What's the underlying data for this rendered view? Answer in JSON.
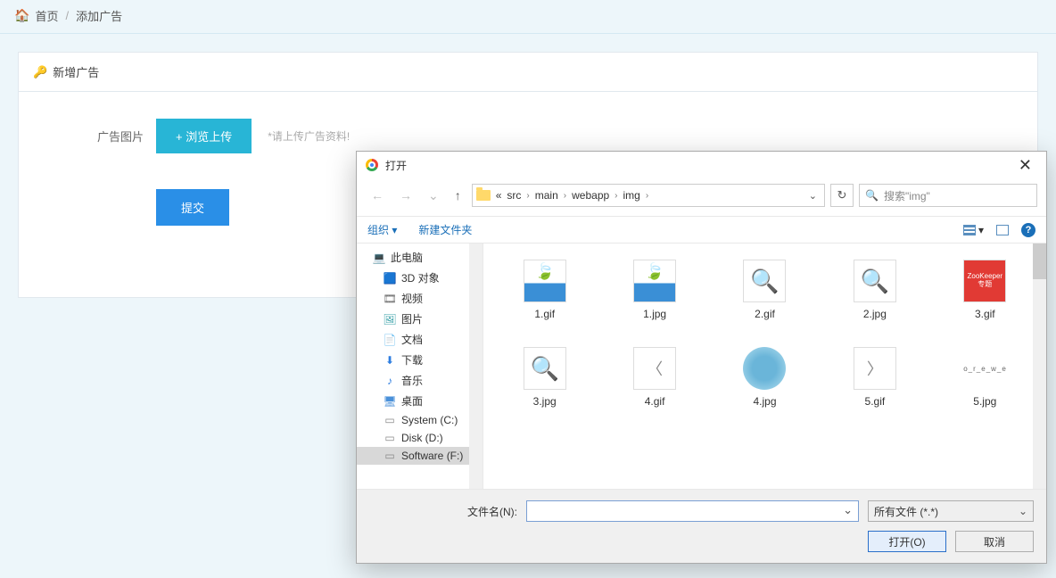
{
  "breadcrumb": {
    "home": "首页",
    "current": "添加广告"
  },
  "panel": {
    "title": "新增广告",
    "img_label": "广告图片",
    "browse_btn": "+ 浏览上传",
    "hint": "*请上传广告资料!",
    "submit": "提交"
  },
  "dialog": {
    "title": "打开",
    "path": {
      "pre": "«",
      "segs": [
        "src",
        "main",
        "webapp",
        "img"
      ]
    },
    "search_placeholder": "搜索\"img\"",
    "toolbar": {
      "organize": "组织",
      "newfolder": "新建文件夹"
    },
    "tree": [
      {
        "label": "此电脑",
        "ic": "pc",
        "sub": false
      },
      {
        "label": "3D 对象",
        "ic": "3d",
        "sub": true
      },
      {
        "label": "视频",
        "ic": "vid",
        "sub": true
      },
      {
        "label": "图片",
        "ic": "img",
        "sub": true
      },
      {
        "label": "文档",
        "ic": "doc",
        "sub": true
      },
      {
        "label": "下载",
        "ic": "dl",
        "sub": true
      },
      {
        "label": "音乐",
        "ic": "mus",
        "sub": true
      },
      {
        "label": "桌面",
        "ic": "desk",
        "sub": true
      },
      {
        "label": "System (C:)",
        "ic": "drv",
        "sub": true
      },
      {
        "label": "Disk (D:)",
        "ic": "drv",
        "sub": true
      },
      {
        "label": "Software (F:)",
        "ic": "drv",
        "sub": true,
        "selected": true
      }
    ],
    "files": [
      {
        "name": "1.gif",
        "thumb": "logo"
      },
      {
        "name": "1.jpg",
        "thumb": "logo"
      },
      {
        "name": "2.gif",
        "thumb": "mag"
      },
      {
        "name": "2.jpg",
        "thumb": "mag"
      },
      {
        "name": "3.gif",
        "thumb": "red",
        "txt": "ZooKeeper专题"
      },
      {
        "name": "3.jpg",
        "thumb": "mag"
      },
      {
        "name": "4.gif",
        "thumb": "arrow",
        "txt": "〈"
      },
      {
        "name": "4.jpg",
        "thumb": "round"
      },
      {
        "name": "5.gif",
        "thumb": "arrow",
        "txt": "〉"
      },
      {
        "name": "5.jpg",
        "thumb": "text",
        "txt": "f_o_r_e_w_e_i"
      }
    ],
    "filename_label": "文件名(N):",
    "filetype": "所有文件 (*.*)",
    "open_btn": "打开(O)",
    "cancel_btn": "取消"
  }
}
